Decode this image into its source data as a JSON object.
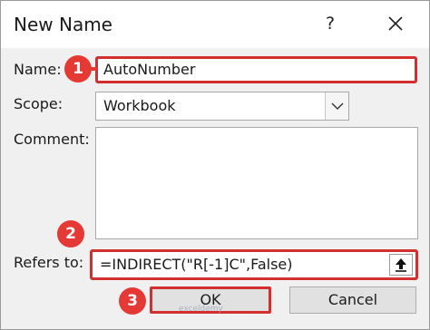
{
  "dialog": {
    "title": "New Name",
    "help_glyph": "?",
    "close_icon": "close-icon"
  },
  "fields": {
    "name_label": "Name:",
    "name_value": "AutoNumber",
    "scope_label": "Scope:",
    "scope_value": "Workbook",
    "comment_label": "Comment:",
    "comment_value": "",
    "refers_label": "Refers to:",
    "refers_value": "=INDIRECT(\"R[-1]C\",False)"
  },
  "buttons": {
    "ok": "OK",
    "cancel": "Cancel"
  },
  "annotations": {
    "step1": "1",
    "step2": "2",
    "step3": "3",
    "color": "#e53935"
  },
  "watermark": "exceldemy"
}
